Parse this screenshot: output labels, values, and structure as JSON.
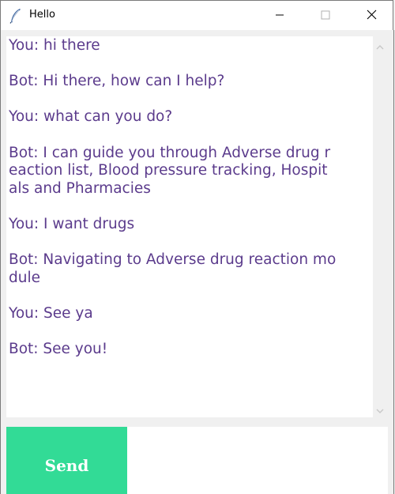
{
  "window": {
    "title": "Hello",
    "minimize_icon": "minimize-icon",
    "maximize_icon": "maximize-icon",
    "close_icon": "close-icon",
    "app_icon": "feather-icon"
  },
  "chat": {
    "text_color": "#5b3b8c",
    "messages": [
      {
        "lines": [
          "You: hi there"
        ]
      },
      {
        "lines": [
          "Bot: Hi there, how can I help?"
        ]
      },
      {
        "lines": [
          "You: what can you do?"
        ]
      },
      {
        "lines": [
          "Bot: I can guide you through Adverse drug r",
          "eaction list, Blood pressure tracking, Hospit",
          "als and Pharmacies"
        ]
      },
      {
        "lines": [
          "You: I want drugs"
        ]
      },
      {
        "lines": [
          "Bot: Navigating to Adverse drug reaction mo",
          "dule"
        ]
      },
      {
        "lines": [
          "You: See ya"
        ]
      },
      {
        "lines": [
          "Bot: See you!"
        ]
      }
    ]
  },
  "controls": {
    "send_label": "Send",
    "send_color": "#32db96",
    "input_value": ""
  }
}
